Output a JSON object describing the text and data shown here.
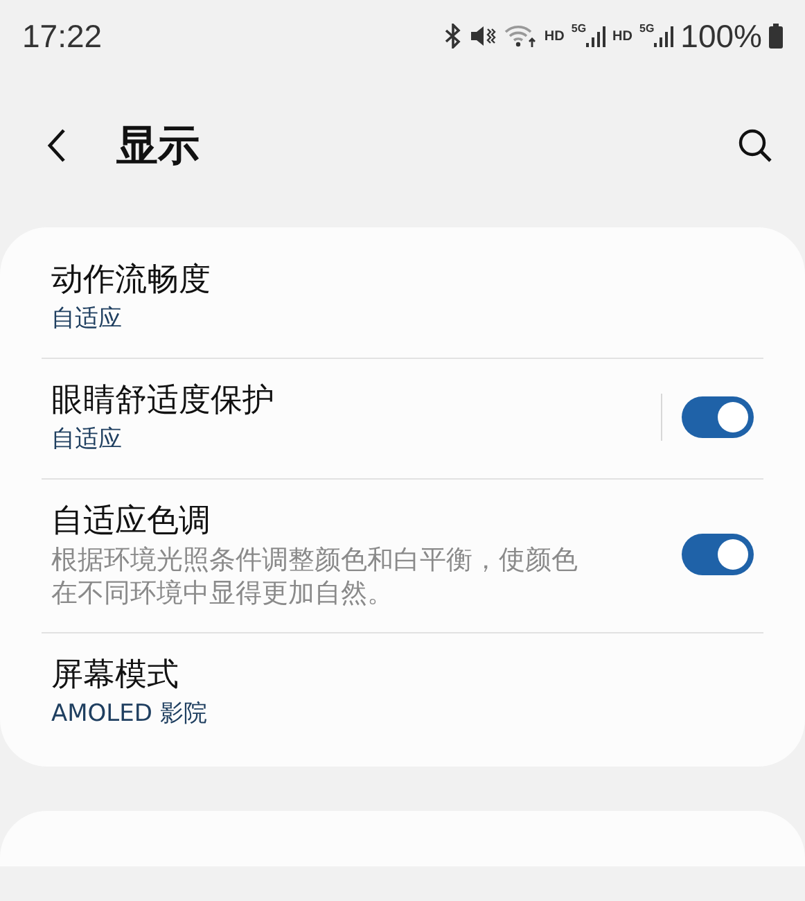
{
  "status_bar": {
    "time": "17:22",
    "network_labels": [
      "HD",
      "5G",
      "HD",
      "5G"
    ],
    "battery": "100%"
  },
  "header": {
    "title": "显示"
  },
  "settings": [
    {
      "title": "动作流畅度",
      "subtitle": {
        "kind": "summary",
        "text": "自适应"
      },
      "kind": "link"
    },
    {
      "title": "眼睛舒适度保护",
      "subtitle": {
        "kind": "summary",
        "text": "自适应"
      },
      "kind": "split_switch",
      "on": true
    },
    {
      "title": "自适应色调",
      "subtitle": {
        "kind": "description",
        "text": "根据环境光照条件调整颜色和白平衡，使颜色在不同环境中显得更加自然。"
      },
      "kind": "switch",
      "on": true
    },
    {
      "title": "屏幕模式",
      "subtitle": {
        "kind": "summary",
        "text": "AMOLED 影院"
      },
      "kind": "link"
    }
  ]
}
